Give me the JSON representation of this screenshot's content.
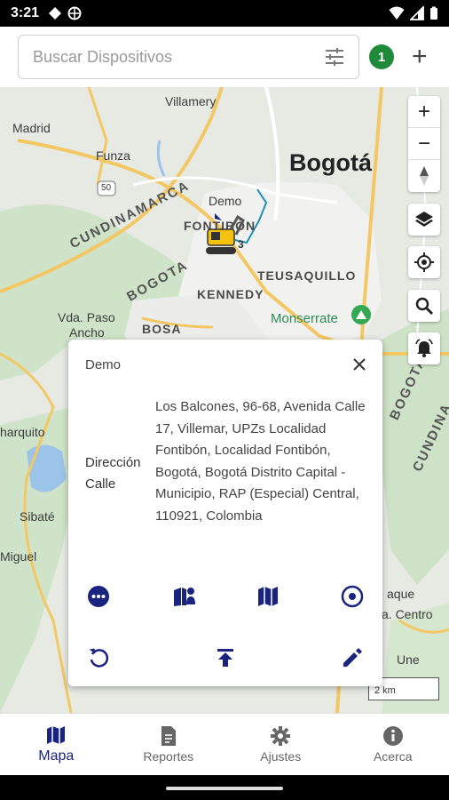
{
  "status_bar": {
    "time": "3:21"
  },
  "search": {
    "placeholder": "Buscar Dispositivos",
    "value": ""
  },
  "top_bar": {
    "badge_count": "1"
  },
  "map": {
    "labels": {
      "villamery": "Villamery",
      "madrid": "Madrid",
      "funza": "Funza",
      "route50": "50",
      "bogota": "Bogotá",
      "demo": "Demo",
      "fontibon": "FONTIBÓN",
      "cundinamarca": "CUNDINAMARCA",
      "teusaquillo": "TEUSAQUILLO",
      "bogota_region": "BOGOTA",
      "kennedy": "KENNEDY",
      "monserrate": "Monserrate",
      "vda_paso": "Vda. Paso",
      "ancho": "Ancho",
      "bosa": "BOSA",
      "charquito": "harquito",
      "sibate": "Sibaté",
      "miguel": "Miguel",
      "bogota_right": "BOGOTA",
      "cundinamarca_right": "CUNDINA",
      "vaque": "aque",
      "centro": "a. Centro",
      "une": "Une",
      "marker_number": "3"
    },
    "scale": "2 km"
  },
  "popup": {
    "title": "Demo",
    "field_label": "Dirección Calle",
    "field_value": "Los Balcones, 96-68, Avenida Calle 17, Villemar, UPZs Localidad Fontibón, Localidad Fontibón, Bogotá, Bogotá Distrito Capital - Municipio, RAP (Especial) Central, 110921, Colombia"
  },
  "nav": {
    "items": [
      {
        "label": "Mapa",
        "icon": "map-icon"
      },
      {
        "label": "Reportes",
        "icon": "report-icon"
      },
      {
        "label": "Ajustes",
        "icon": "gear-icon"
      },
      {
        "label": "Acerca",
        "icon": "info-icon"
      }
    ]
  },
  "colors": {
    "accent": "#1a237e",
    "badge": "#1f8a3a",
    "park": "#2e8b57"
  }
}
